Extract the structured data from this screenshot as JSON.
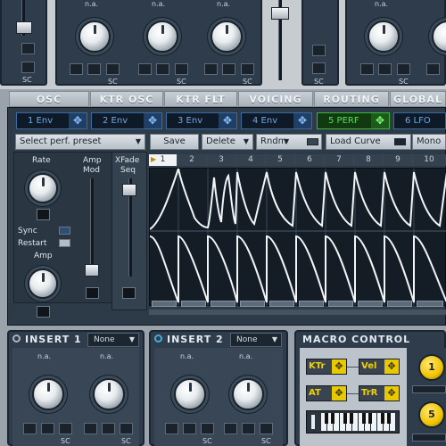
{
  "top": {
    "knob_labels": [
      "n.a.",
      "n.a.",
      "n.a.",
      "n.a."
    ],
    "sc_label": "SC"
  },
  "section_tabs": [
    "OSC",
    "KTR OSC",
    "KTR FLT",
    "VOICING",
    "ROUTING",
    "GLOBAL"
  ],
  "env_tabs": [
    "1 Env",
    "2 Env",
    "3 Env",
    "4 Env",
    "5 PERF",
    "6 LFO"
  ],
  "env_tab_icon": "move-cross-icon",
  "toolbar": {
    "preset_select": "Select perf. preset",
    "save": "Save",
    "delete": "Delete",
    "rndm": "Rndm",
    "load_curve": "Load Curve",
    "mono": "Mono"
  },
  "lfo": {
    "rate": "Rate",
    "sync": "Sync",
    "restart": "Restart",
    "amp": "Amp",
    "amp_mod_1": "Amp",
    "amp_mod_2": "Mod",
    "xfade_1": "XFade",
    "xfade_2": "Seq"
  },
  "sequencer": {
    "steps": [
      "1",
      "2",
      "3",
      "4",
      "5",
      "6",
      "7",
      "8",
      "9",
      "10"
    ],
    "current_step": 1
  },
  "inserts": [
    {
      "title": "INSERT 1",
      "mode": "None",
      "knob_labels": [
        "n.a.",
        "n.a."
      ],
      "sc": "SC"
    },
    {
      "title": "INSERT 2",
      "mode": "None",
      "knob_labels": [
        "n.a.",
        "n.a."
      ],
      "sc": "SC"
    }
  ],
  "macro": {
    "title": "MACRO CONTROL",
    "buttons": [
      "KTr",
      "Vel",
      "AT",
      "TrR"
    ],
    "knob_values": [
      "1",
      "5"
    ]
  },
  "colors": {
    "panel": "#2d3a48",
    "env_active": "#54e04f",
    "env_inactive": "#6fa7e6",
    "macro_accent": "#f0d200"
  }
}
